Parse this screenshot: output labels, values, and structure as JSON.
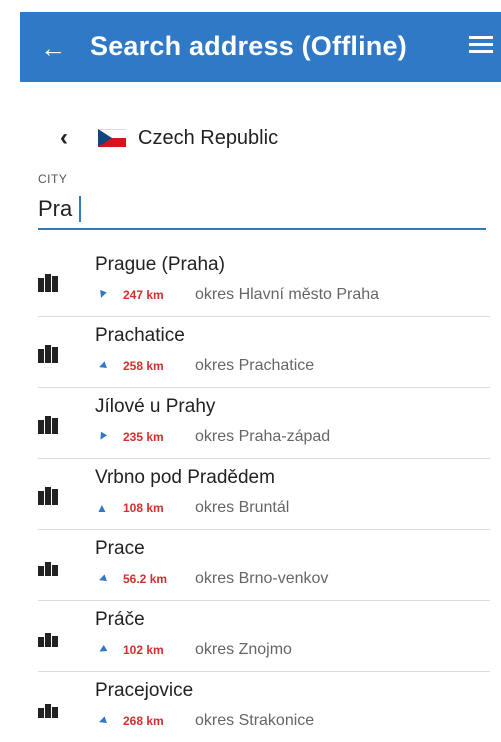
{
  "header": {
    "title": "Search address (Offline)"
  },
  "country": {
    "name": "Czech Republic"
  },
  "city": {
    "label": "CITY",
    "value": "Pra"
  },
  "results": [
    {
      "name": "Prague (Praha)",
      "distance": "247 km",
      "region": "okres Hlavní město Praha",
      "heading_deg": 200,
      "size": "large"
    },
    {
      "name": "Prachatice",
      "distance": "258 km",
      "region": "okres Prachatice",
      "heading_deg": 250,
      "size": "large"
    },
    {
      "name": "Jílové u Prahy",
      "distance": "235 km",
      "region": "okres Praha-západ",
      "heading_deg": 210,
      "size": "large"
    },
    {
      "name": "Vrbno pod Pradědem",
      "distance": "108 km",
      "region": "okres Bruntál",
      "heading_deg": 0,
      "size": "large"
    },
    {
      "name": "Prace",
      "distance": "56.2 km",
      "region": "okres Brno-venkov",
      "heading_deg": 250,
      "size": "small"
    },
    {
      "name": "Práče",
      "distance": "102 km",
      "region": "okres Znojmo",
      "heading_deg": 240,
      "size": "small"
    },
    {
      "name": "Pracejovice",
      "distance": "268 km",
      "region": "okres Strakonice",
      "heading_deg": 250,
      "size": "small"
    }
  ]
}
